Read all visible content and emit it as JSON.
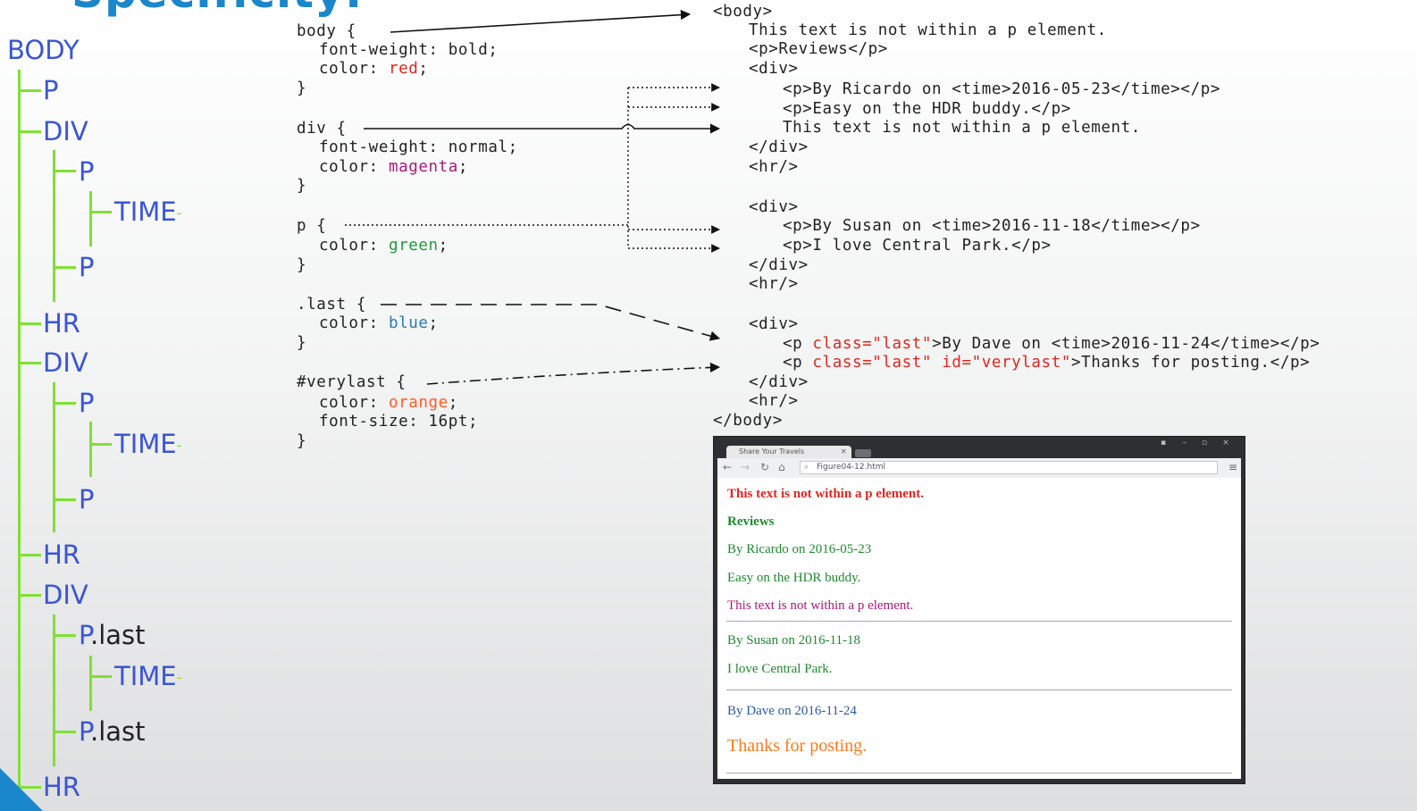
{
  "slide": {
    "title": "Specificity:"
  },
  "tree": {
    "nodes": [
      {
        "label": "BODY"
      },
      {
        "label": "P"
      },
      {
        "label": "DIV"
      },
      {
        "label": "P"
      },
      {
        "label": "TIME"
      },
      {
        "label": "P"
      },
      {
        "label": "HR"
      },
      {
        "label": "DIV"
      },
      {
        "label": "P"
      },
      {
        "label": "TIME"
      },
      {
        "label": "P"
      },
      {
        "label": "HR"
      },
      {
        "label": "DIV"
      },
      {
        "label": "P",
        "class": ".last"
      },
      {
        "label": "TIME"
      },
      {
        "label": "P",
        "class": ".last"
      },
      {
        "label": "HR"
      }
    ]
  },
  "css_code": {
    "body_rule": {
      "selector": "body {",
      "prop1": "font-weight: ",
      "val1": "bold",
      "prop2": "color: ",
      "val2": "red",
      "close": "}"
    },
    "div_rule": {
      "selector": "div {",
      "prop1": "font-weight: ",
      "val1": "normal",
      "prop2": "color: ",
      "val2": "magenta",
      "close": "}"
    },
    "p_rule": {
      "selector": "p {",
      "prop1": "color: ",
      "val1": "green",
      "close": "}"
    },
    "last_rule": {
      "selector": ".last {",
      "prop1": "color: ",
      "val1": "blue",
      "close": "}"
    },
    "verylast_rule": {
      "selector": "#verylast {",
      "prop1": "color: ",
      "val1": "orange",
      "prop2": "font-size: ",
      "val2": "16pt",
      "close": "}"
    }
  },
  "html_code": {
    "lines": [
      "<body>",
      "This text is not within a p element.",
      "<p>Reviews</p>",
      "<div>",
      "<p>By Ricardo on <time>2016-05-23</time></p>",
      "<p>Easy on the HDR buddy.</p>",
      "This text is not within a p element.",
      "</div>",
      "<hr/>",
      "<div>",
      "<p>By Susan on <time>2016-11-18</time></p>",
      "<p>I love Central Park.</p>",
      "</div>",
      "<hr/>",
      "<div>",
      "<p ",
      "class=\"last\"",
      ">By Dave on <time>2016-11-24</time></p>",
      "<p ",
      "class=\"last\" id=\"verylast\"",
      ">Thanks for posting.</p>",
      "</div>",
      "<hr/>",
      "</body>"
    ]
  },
  "browser": {
    "tab_title": "Share Your Travels",
    "address": "Figure04-12.html",
    "content": {
      "line1": "This text is not within a p element.",
      "reviews": "Reviews",
      "ricardo": "By Ricardo on 2016-05-23",
      "easy": "Easy on the HDR buddy.",
      "line2": "This text is not within a p element.",
      "susan": "By Susan on 2016-11-18",
      "central": "I love Central Park.",
      "dave": "By Dave on 2016-11-24",
      "thanks": "Thanks for posting."
    }
  },
  "colors": {
    "title_blue": "#1a86cc",
    "tree_node": "#3a55d6",
    "tree_line": "#7fe133",
    "red": "#e0261f",
    "magenta": "#b0187a",
    "green": "#1f9c3a",
    "blue": "#2a7ab8",
    "orange": "#ff5d22"
  }
}
